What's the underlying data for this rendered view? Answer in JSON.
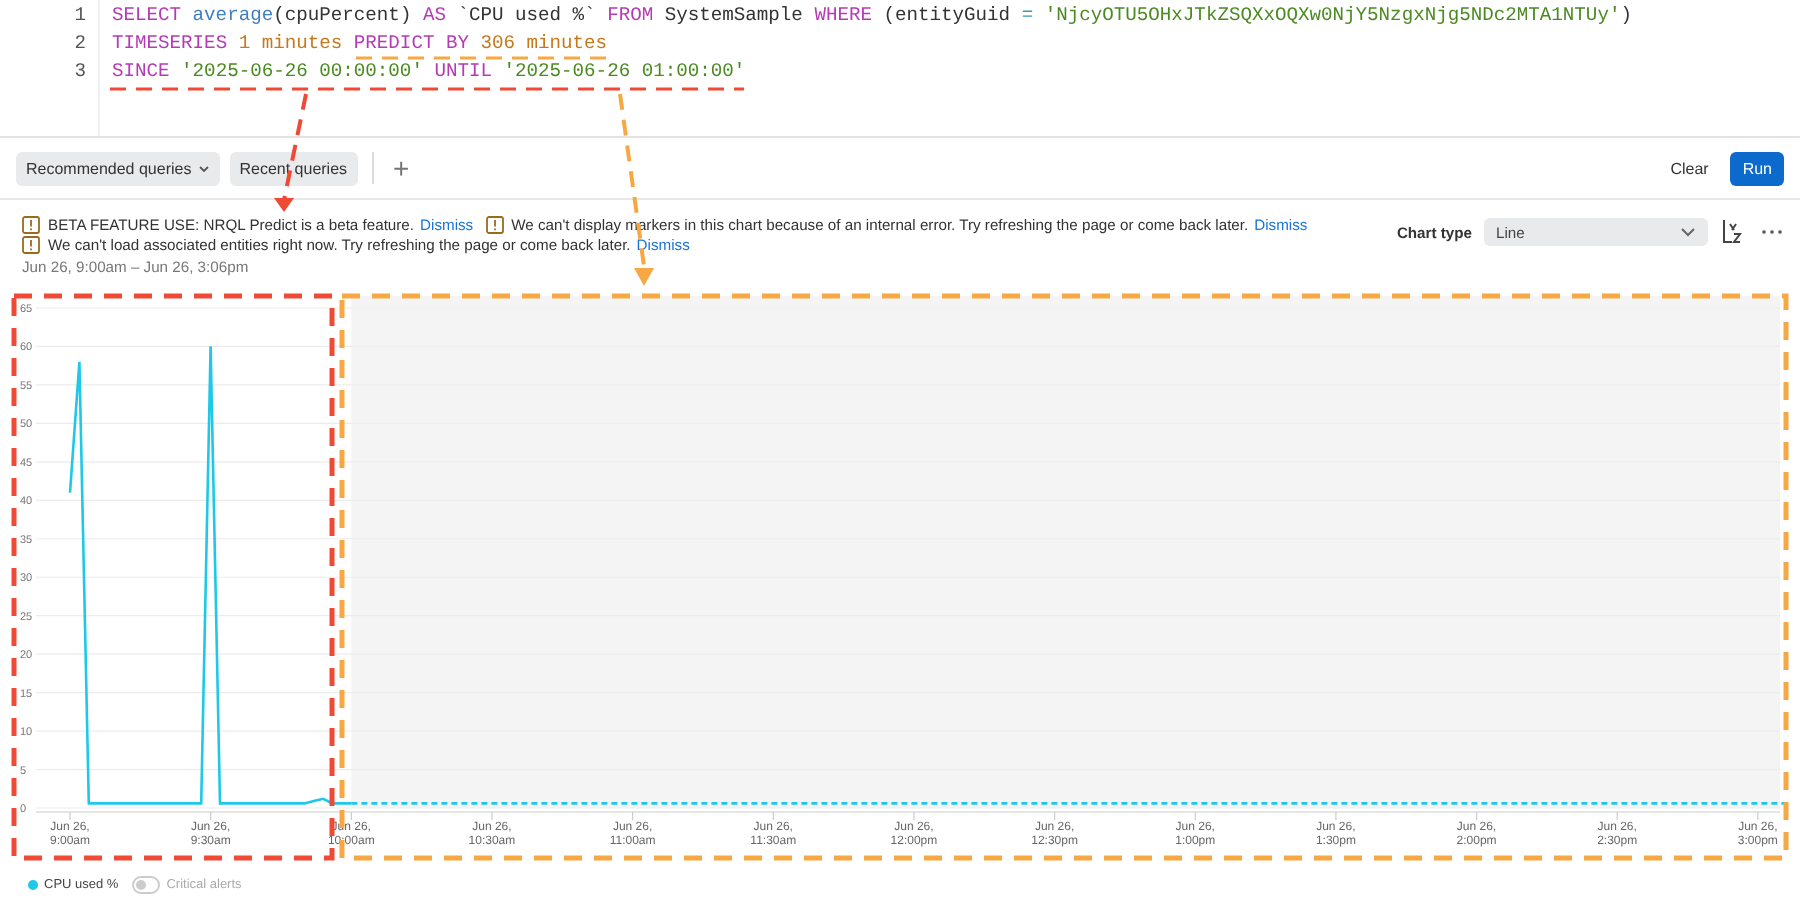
{
  "editor": {
    "lines": [
      {
        "number": "1",
        "tokens": [
          {
            "kind": "keyword",
            "text": "SELECT"
          },
          {
            "kind": "function",
            "text": "average"
          },
          {
            "kind": "plain",
            "text": "(cpuPercent)",
            "attached": true
          },
          {
            "kind": "keyword",
            "text": "AS"
          },
          {
            "kind": "plain",
            "text": "`CPU used %`"
          },
          {
            "kind": "keyword",
            "text": "FROM"
          },
          {
            "kind": "plain",
            "text": "SystemSample"
          },
          {
            "kind": "keyword",
            "text": "WHERE"
          },
          {
            "kind": "plain",
            "text": "(entityGuid"
          },
          {
            "kind": "operator",
            "text": "="
          },
          {
            "kind": "string",
            "text": "'NjcyOTU5OHxJTkZSQXxOQXw0NjY5NzgxNjg5NDc2MTA1NTUy'"
          },
          {
            "kind": "close",
            "text": ")"
          }
        ]
      },
      {
        "number": "2",
        "tokens": [
          {
            "kind": "keyword",
            "text": "TIMESERIES"
          },
          {
            "kind": "number",
            "text": "1 minutes"
          },
          {
            "kind": "keyword",
            "text": "PREDICT"
          },
          {
            "kind": "keyword",
            "text": "BY"
          },
          {
            "kind": "number",
            "text": "306 minutes"
          }
        ]
      },
      {
        "number": "3",
        "tokens": [
          {
            "kind": "keyword",
            "text": "SINCE"
          },
          {
            "kind": "string",
            "text": "'2025-06-26 00:00:00'"
          },
          {
            "kind": "keyword",
            "text": "UNTIL"
          },
          {
            "kind": "string",
            "text": "'2025-06-26 01:00:00'"
          }
        ]
      }
    ]
  },
  "toolbar": {
    "left": [
      {
        "label": "Recommended queries",
        "dropdown": true
      },
      {
        "label": "Recent queries",
        "dropdown": false
      }
    ],
    "add": "+",
    "clear": "Clear",
    "run": "Run"
  },
  "notices": [
    {
      "text": "BETA FEATURE USE: NRQL Predict is a beta feature.",
      "link": "Dismiss"
    },
    {
      "text": "We can't display markers in this chart because of an internal error. Try refreshing the page or come back later.",
      "link": "Dismiss"
    },
    {
      "text": "We can't load associated entities right now. Try refreshing the page or come back later.",
      "link": "Dismiss"
    }
  ],
  "time_range": "Jun 26, 9:00am – Jun 26, 3:06pm",
  "chart_type": {
    "label": "Chart type",
    "value": "Line"
  },
  "chart": {
    "chart_data": {
      "type": "line",
      "categories": [
        "Jun 26, 9:00am",
        null,
        null,
        null,
        null,
        null,
        null,
        null,
        null,
        null,
        null,
        null,
        null,
        null,
        null,
        "Jun 26, 9:30am",
        null,
        null,
        null,
        null,
        null,
        null,
        null,
        null,
        null,
        null,
        null,
        null,
        null,
        null,
        "Jun 26, 10:00am",
        null,
        null,
        null,
        null,
        null,
        null,
        null,
        null,
        null,
        null,
        null,
        null,
        null,
        null,
        "Jun 26, 10:30am",
        null,
        null,
        null,
        null,
        null,
        null,
        null,
        null,
        null,
        null,
        null,
        null,
        null,
        null,
        "Jun 26, 11:00am",
        null,
        null,
        null,
        null,
        null,
        null,
        null,
        null,
        null,
        null,
        null,
        null,
        null,
        null,
        "Jun 26, 11:30am",
        null,
        null,
        null,
        null,
        null,
        null,
        null,
        null,
        null,
        null,
        null,
        null,
        null,
        null,
        "Jun 26, 12:00pm",
        null,
        null,
        null,
        null,
        null,
        null,
        null,
        null,
        null,
        null,
        null,
        null,
        null,
        null,
        "Jun 26, 12:30pm",
        null,
        null,
        null,
        null,
        null,
        null,
        null,
        null,
        null,
        null,
        null,
        null,
        null,
        null,
        "Jun 26, 1:00pm",
        null,
        null,
        null,
        null,
        null,
        null,
        null,
        null,
        null,
        null,
        null,
        null,
        null,
        null,
        "Jun 26, 1:30pm",
        null,
        null,
        null,
        null,
        null,
        null,
        null,
        null,
        null,
        null,
        null,
        null,
        null,
        null,
        "Jun 26, 2:00pm",
        null,
        null,
        null,
        null,
        null,
        null,
        null,
        null,
        null,
        null,
        null,
        null,
        null,
        null,
        "Jun 26, 2:30pm",
        null,
        null,
        null,
        null,
        null,
        null,
        null,
        null,
        null,
        null,
        null,
        null,
        null,
        null,
        "Jun 26, 3:00pm",
        null,
        null,
        null
      ],
      "series": [
        {
          "name": "CPU used %",
          "color": "#1fc8e8",
          "line_style": "solid",
          "values": [
            41,
            58,
            0.6,
            0.6,
            0.6,
            0.6,
            0.6,
            0.6,
            0.6,
            0.6,
            0.6,
            0.6,
            0.6,
            0.6,
            0.6,
            60,
            0.6,
            0.6,
            0.6,
            0.6,
            0.6,
            0.6,
            0.6,
            0.6,
            0.6,
            0.6,
            0.9,
            1.2,
            0.6,
            0.6,
            0.6,
            null,
            null,
            null,
            null,
            null,
            null,
            null,
            null,
            null,
            null,
            null,
            null,
            null,
            null,
            null,
            null,
            null,
            null,
            null,
            null,
            null,
            null,
            null,
            null,
            null,
            null,
            null,
            null,
            null,
            null,
            null,
            null,
            null,
            null,
            null,
            null,
            null,
            null,
            null,
            null,
            null,
            null,
            null,
            null,
            null,
            null,
            null,
            null,
            null,
            null,
            null,
            null,
            null,
            null,
            null,
            null,
            null,
            null,
            null,
            null,
            null,
            null,
            null,
            null,
            null,
            null,
            null,
            null,
            null,
            null,
            null,
            null,
            null,
            null,
            null,
            null,
            null,
            null,
            null,
            null,
            null,
            null,
            null,
            null,
            null,
            null,
            null,
            null,
            null,
            null,
            null,
            null,
            null,
            null,
            null,
            null,
            null,
            null,
            null,
            null,
            null,
            null,
            null,
            null,
            null,
            null,
            null,
            null,
            null,
            null,
            null,
            null,
            null,
            null,
            null,
            null,
            null,
            null,
            null,
            null,
            null,
            null,
            null,
            null,
            null,
            null,
            null,
            null,
            null,
            null,
            null,
            null,
            null,
            null,
            null,
            null,
            null,
            null,
            null,
            null,
            null,
            null,
            null,
            null,
            null,
            null,
            null,
            null,
            null,
            null,
            null,
            null,
            null
          ]
        },
        {
          "color": "#1fc8e8",
          "line_style": "dashed",
          "values": [
            null,
            null,
            null,
            null,
            null,
            null,
            null,
            null,
            null,
            null,
            null,
            null,
            null,
            null,
            null,
            null,
            null,
            null,
            null,
            null,
            null,
            null,
            null,
            null,
            null,
            null,
            null,
            null,
            null,
            null,
            0.6,
            0.6,
            0.6,
            0.6,
            0.6,
            0.6,
            0.6,
            0.6,
            0.6,
            0.6,
            0.6,
            0.6,
            0.6,
            0.6,
            0.6,
            0.6,
            0.6,
            0.6,
            0.6,
            0.6,
            0.6,
            0.6,
            0.6,
            0.6,
            0.6,
            0.6,
            0.6,
            0.6,
            0.6,
            0.6,
            0.6,
            0.6,
            0.6,
            0.6,
            0.6,
            0.6,
            0.6,
            0.6,
            0.6,
            0.6,
            0.6,
            0.6,
            0.6,
            0.6,
            0.6,
            0.6,
            0.6,
            0.6,
            0.6,
            0.6,
            0.6,
            0.6,
            0.6,
            0.6,
            0.6,
            0.6,
            0.6,
            0.6,
            0.6,
            0.6,
            0.6,
            0.6,
            0.6,
            0.6,
            0.6,
            0.6,
            0.6,
            0.6,
            0.6,
            0.6,
            0.6,
            0.6,
            0.6,
            0.6,
            0.6,
            0.6,
            0.6,
            0.6,
            0.6,
            0.6,
            0.6,
            0.6,
            0.6,
            0.6,
            0.6,
            0.6,
            0.6,
            0.6,
            0.6,
            0.6,
            0.6,
            0.6,
            0.6,
            0.6,
            0.6,
            0.6,
            0.6,
            0.6,
            0.6,
            0.6,
            0.6,
            0.6,
            0.6,
            0.6,
            0.6,
            0.6,
            0.6,
            0.6,
            0.6,
            0.6,
            0.6,
            0.6,
            0.6,
            0.6,
            0.6,
            0.6,
            0.6,
            0.6,
            0.6,
            0.6,
            0.6,
            0.6,
            0.6,
            0.6,
            0.6,
            0.6,
            0.6,
            0.6,
            0.6,
            0.6,
            0.6,
            0.6,
            0.6,
            0.6,
            0.6,
            0.6,
            0.6,
            0.6,
            0.6,
            0.6,
            0.6,
            0.6,
            0.6,
            0.6,
            0.6,
            0.6,
            0.6,
            0.6,
            0.6,
            0.6,
            0.6,
            0.6,
            0.6,
            0.6
          ]
        }
      ],
      "grid": true,
      "ylim": [
        0,
        65
      ],
      "yticks": [
        0,
        5,
        10,
        15,
        20,
        25,
        30,
        35,
        40,
        45,
        50,
        55,
        60,
        65
      ]
    }
  },
  "legend": {
    "toggle": {
      "label": "Critical alerts",
      "on": false
    }
  },
  "highlights": [
    {
      "color": "#f04a36"
    },
    {
      "color": "#f8a842"
    }
  ]
}
